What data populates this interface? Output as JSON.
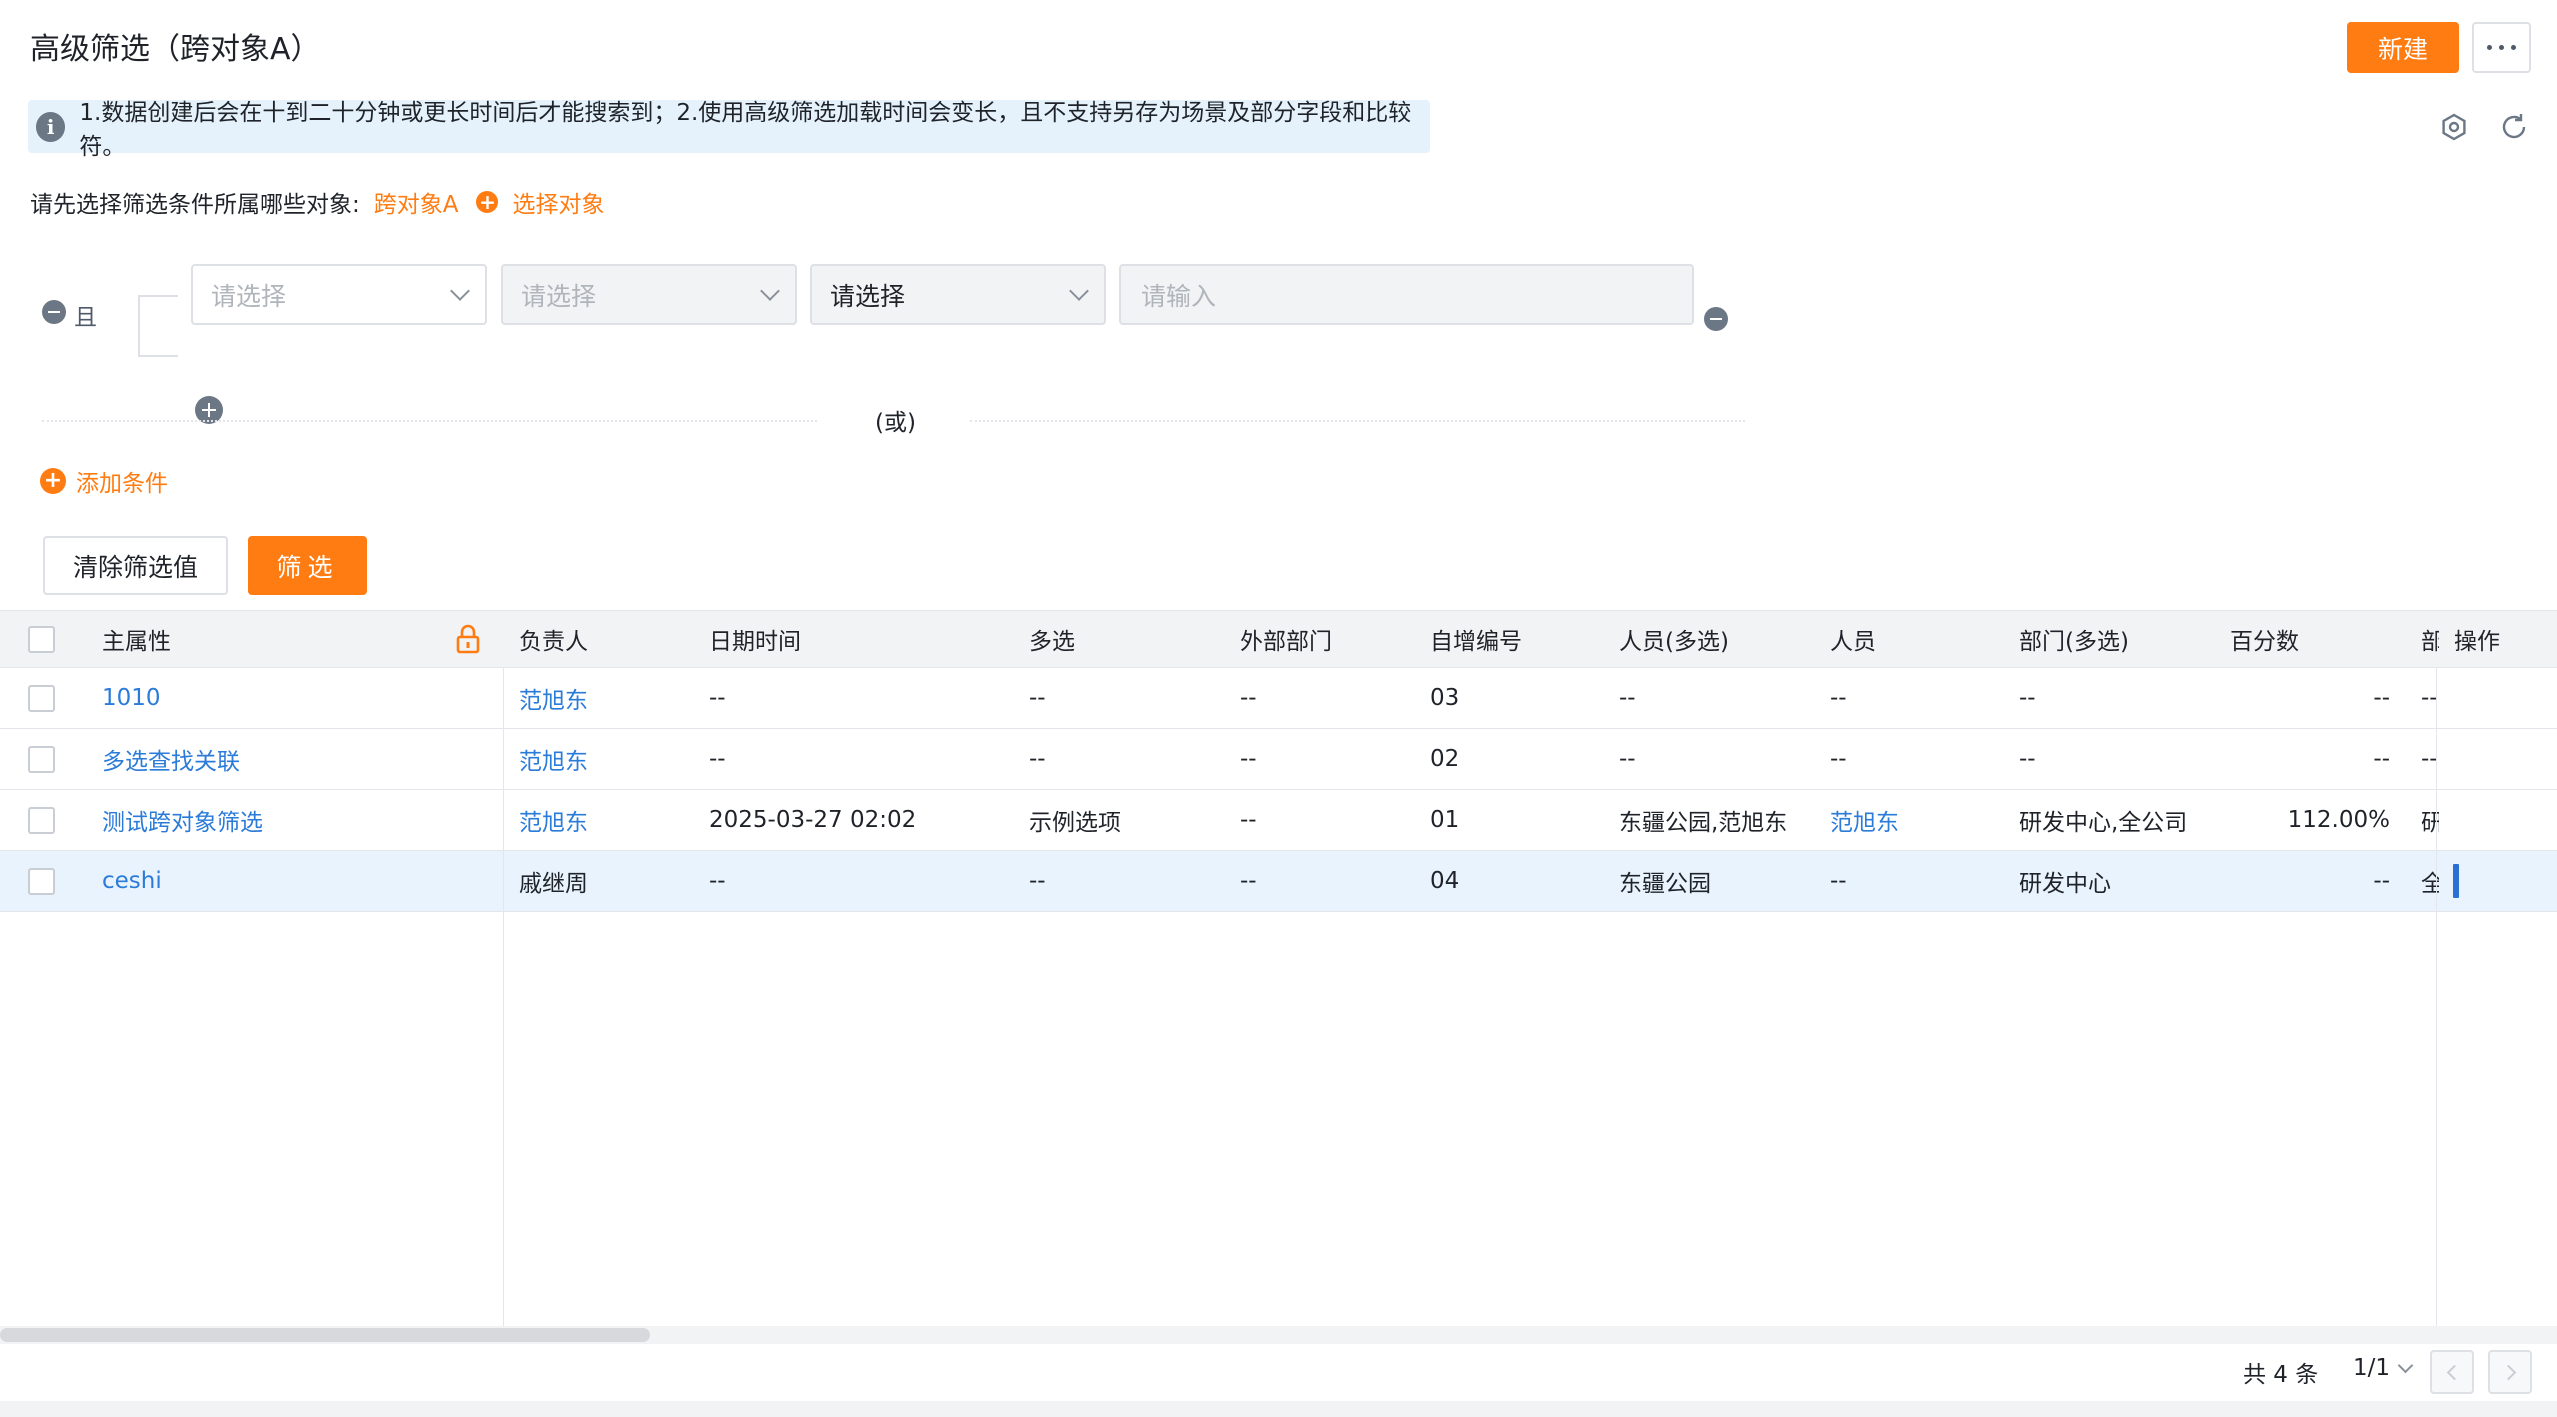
{
  "header": {
    "title": "高级筛选（跨对象A）",
    "new_label": "新建"
  },
  "notice": {
    "text": "1.数据创建后会在十到二十分钟或更长时间后才能搜索到；2.使用高级筛选加载时间会变长，且不支持另存为场景及部分字段和比较符。"
  },
  "objects": {
    "label": "请先选择筛选条件所属哪些对象:",
    "selected": "跨对象A",
    "choose_label": "选择对象"
  },
  "condition": {
    "and_label": "且",
    "field_placeholder": "请选择",
    "operator_placeholder": "请选择",
    "value_type_selected": "请选择",
    "value_placeholder": "请输入",
    "or_label": "(或)",
    "add_condition_label": "添加条件"
  },
  "actions": {
    "clear_label": "清除筛选值",
    "filter_label": "筛选"
  },
  "table": {
    "columns": [
      "主属性",
      "负责人",
      "日期时间",
      "多选",
      "外部部门",
      "自增编号",
      "人员(多选)",
      "人员",
      "部门(多选)",
      "百分数",
      "部",
      "操作"
    ],
    "rows": [
      {
        "main": "1010",
        "owner": "范旭东",
        "datetime": "--",
        "multi": "--",
        "ext_dept": "--",
        "seq": "03",
        "people_multi": "--",
        "person": "--",
        "dept_multi": "--",
        "percent": "--",
        "dept": "--"
      },
      {
        "main": "多选查找关联",
        "owner": "范旭东",
        "datetime": "--",
        "multi": "--",
        "ext_dept": "--",
        "seq": "02",
        "people_multi": "--",
        "person": "--",
        "dept_multi": "--",
        "percent": "--",
        "dept": "--"
      },
      {
        "main": "测试跨对象筛选",
        "owner": "范旭东",
        "datetime": "2025-03-27 02:02",
        "multi": "示例选项",
        "ext_dept": "--",
        "seq": "01",
        "people_multi": "东疆公园,范旭东",
        "person": "范旭东",
        "dept_multi": "研发中心,全公司",
        "percent": "112.00%",
        "dept": "研"
      },
      {
        "main": "ceshi",
        "owner": "戚继周",
        "datetime": "--",
        "multi": "--",
        "ext_dept": "--",
        "seq": "04",
        "people_multi": "东疆公园",
        "person": "--",
        "dept_multi": "研发中心",
        "percent": "--",
        "dept": "全"
      }
    ]
  },
  "footer": {
    "total": "共 4 条",
    "page": "1/1"
  },
  "colors": {
    "accent": "#ff7c12",
    "link": "#2b7bd9",
    "notice_bg": "#e5f2fb",
    "selected_row_bg": "#e8f3fd"
  }
}
